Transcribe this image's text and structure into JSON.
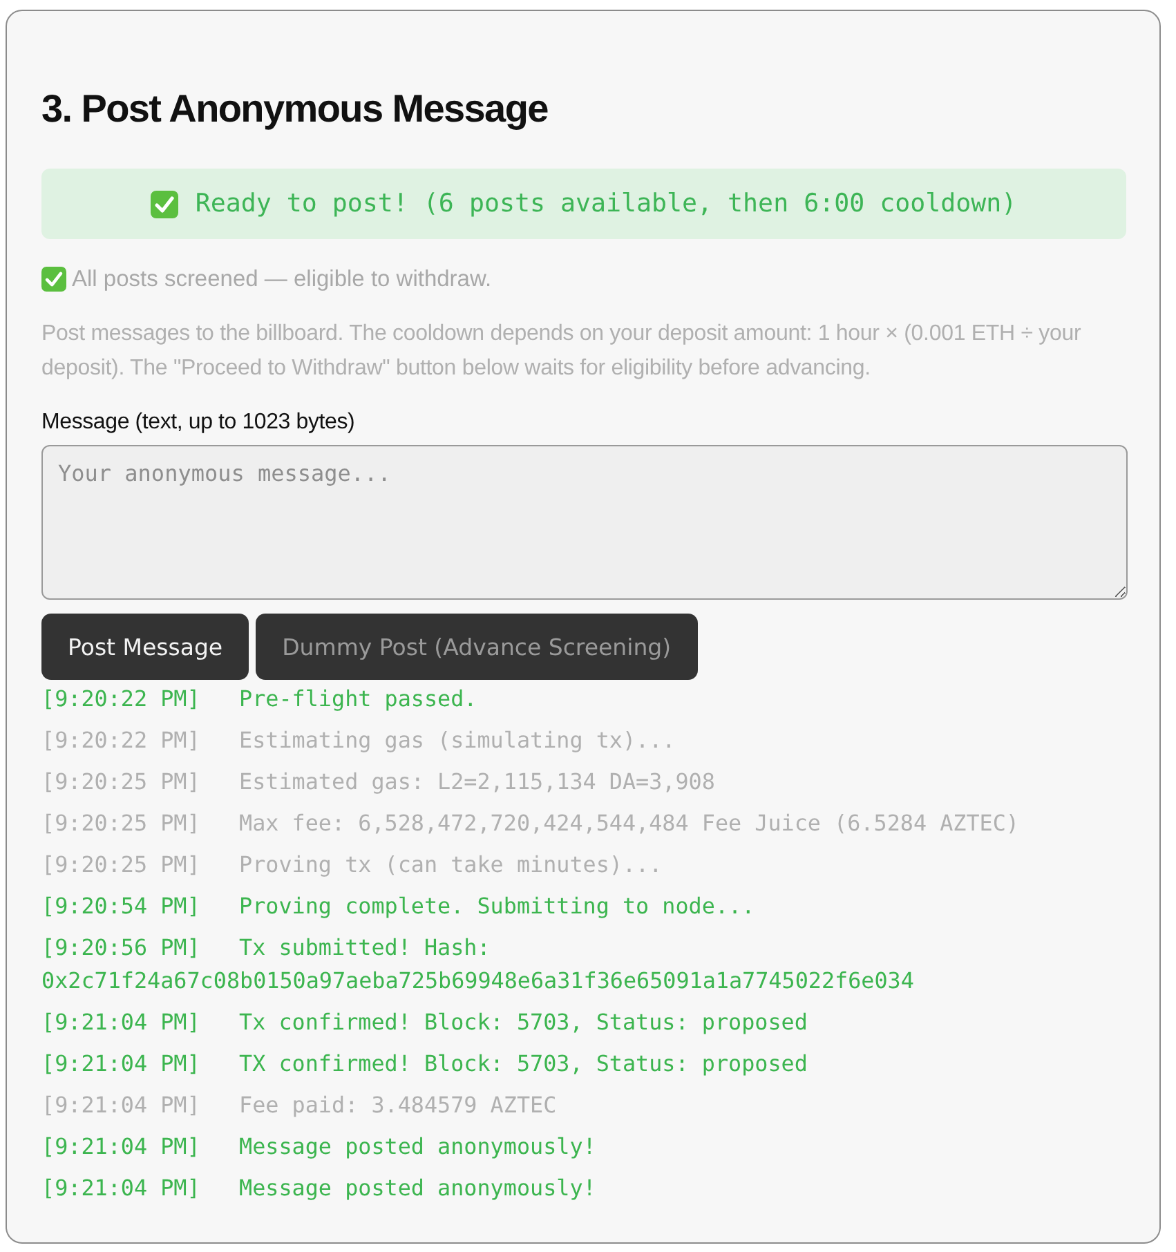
{
  "section": {
    "title": "3. Post Anonymous Message"
  },
  "status_banner": {
    "text": "Ready to post! (6 posts available, then 6:00 cooldown)"
  },
  "screening_note": {
    "text": "All posts screened — eligible to withdraw."
  },
  "description": "Post messages to the billboard. The cooldown depends on your deposit amount: 1 hour × (0.001 ETH ÷ your deposit). The \"Proceed to Withdraw\" button below waits for eligibility before advancing.",
  "message_field": {
    "label": "Message (text, up to 1023 bytes)",
    "placeholder": "Your anonymous message..."
  },
  "buttons": [
    {
      "label": "Post Message",
      "disabled": false
    },
    {
      "label": "Dummy Post (Advance Screening)",
      "disabled": true
    }
  ],
  "log": [
    {
      "time": "[9:20:22 PM]",
      "message": "Pre-flight passed.",
      "kind": "success"
    },
    {
      "time": "[9:20:22 PM]",
      "message": "Estimating gas (simulating tx)...",
      "kind": "info"
    },
    {
      "time": "[9:20:25 PM]",
      "message": "Estimated gas: L2=2,115,134 DA=3,908",
      "kind": "info"
    },
    {
      "time": "[9:20:25 PM]",
      "message": "Max fee: 6,528,472,720,424,544,484 Fee Juice (6.5284 AZTEC)",
      "kind": "info"
    },
    {
      "time": "[9:20:25 PM]",
      "message": "Proving tx (can take minutes)...",
      "kind": "info"
    },
    {
      "time": "[9:20:54 PM]",
      "message": "Proving complete. Submitting to node...",
      "kind": "success"
    },
    {
      "time": "[9:20:56 PM]",
      "message": "Tx submitted! Hash: 0x2c71f24a67c08b0150a97aeba725b69948e6a31f36e65091a1a7745022f6e034",
      "kind": "success"
    },
    {
      "time": "[9:21:04 PM]",
      "message": "Tx confirmed! Block: 5703, Status: proposed",
      "kind": "success"
    },
    {
      "time": "[9:21:04 PM]",
      "message": "TX confirmed! Block: 5703, Status: proposed",
      "kind": "success"
    },
    {
      "time": "[9:21:04 PM]",
      "message": "Fee paid: 3.484579 AZTEC",
      "kind": "info"
    },
    {
      "time": "[9:21:04 PM]",
      "message": "Message posted anonymously!",
      "kind": "success"
    },
    {
      "time": "[9:21:04 PM]",
      "message": "Message posted anonymously!",
      "kind": "success"
    }
  ]
}
